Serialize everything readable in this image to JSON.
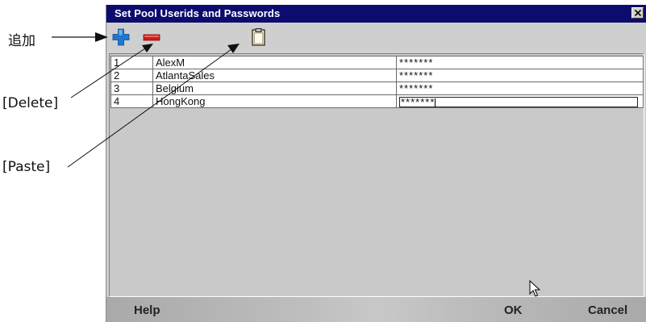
{
  "annotations": {
    "add_label": "追加",
    "delete_label": "[Delete]",
    "paste_label": "[Paste]"
  },
  "dialog": {
    "title": "Set Pool Userids and Passwords",
    "toolbar": {
      "add_icon": "plus-icon",
      "delete_icon": "minus-icon",
      "paste_icon": "clipboard-icon"
    },
    "rows": [
      {
        "num": "1",
        "userid": "AlexM",
        "password": "*******"
      },
      {
        "num": "2",
        "userid": "AtlantaSales",
        "password": "*******"
      },
      {
        "num": "3",
        "userid": "Belgium",
        "password": "*******"
      },
      {
        "num": "4",
        "userid": "HongKong",
        "password": "*******"
      }
    ],
    "buttons": {
      "help": "Help",
      "ok": "OK",
      "cancel": "Cancel"
    },
    "colors": {
      "titlebar": "#0c0c6e",
      "add": "#1e78d2",
      "delete": "#d21a1a"
    }
  }
}
